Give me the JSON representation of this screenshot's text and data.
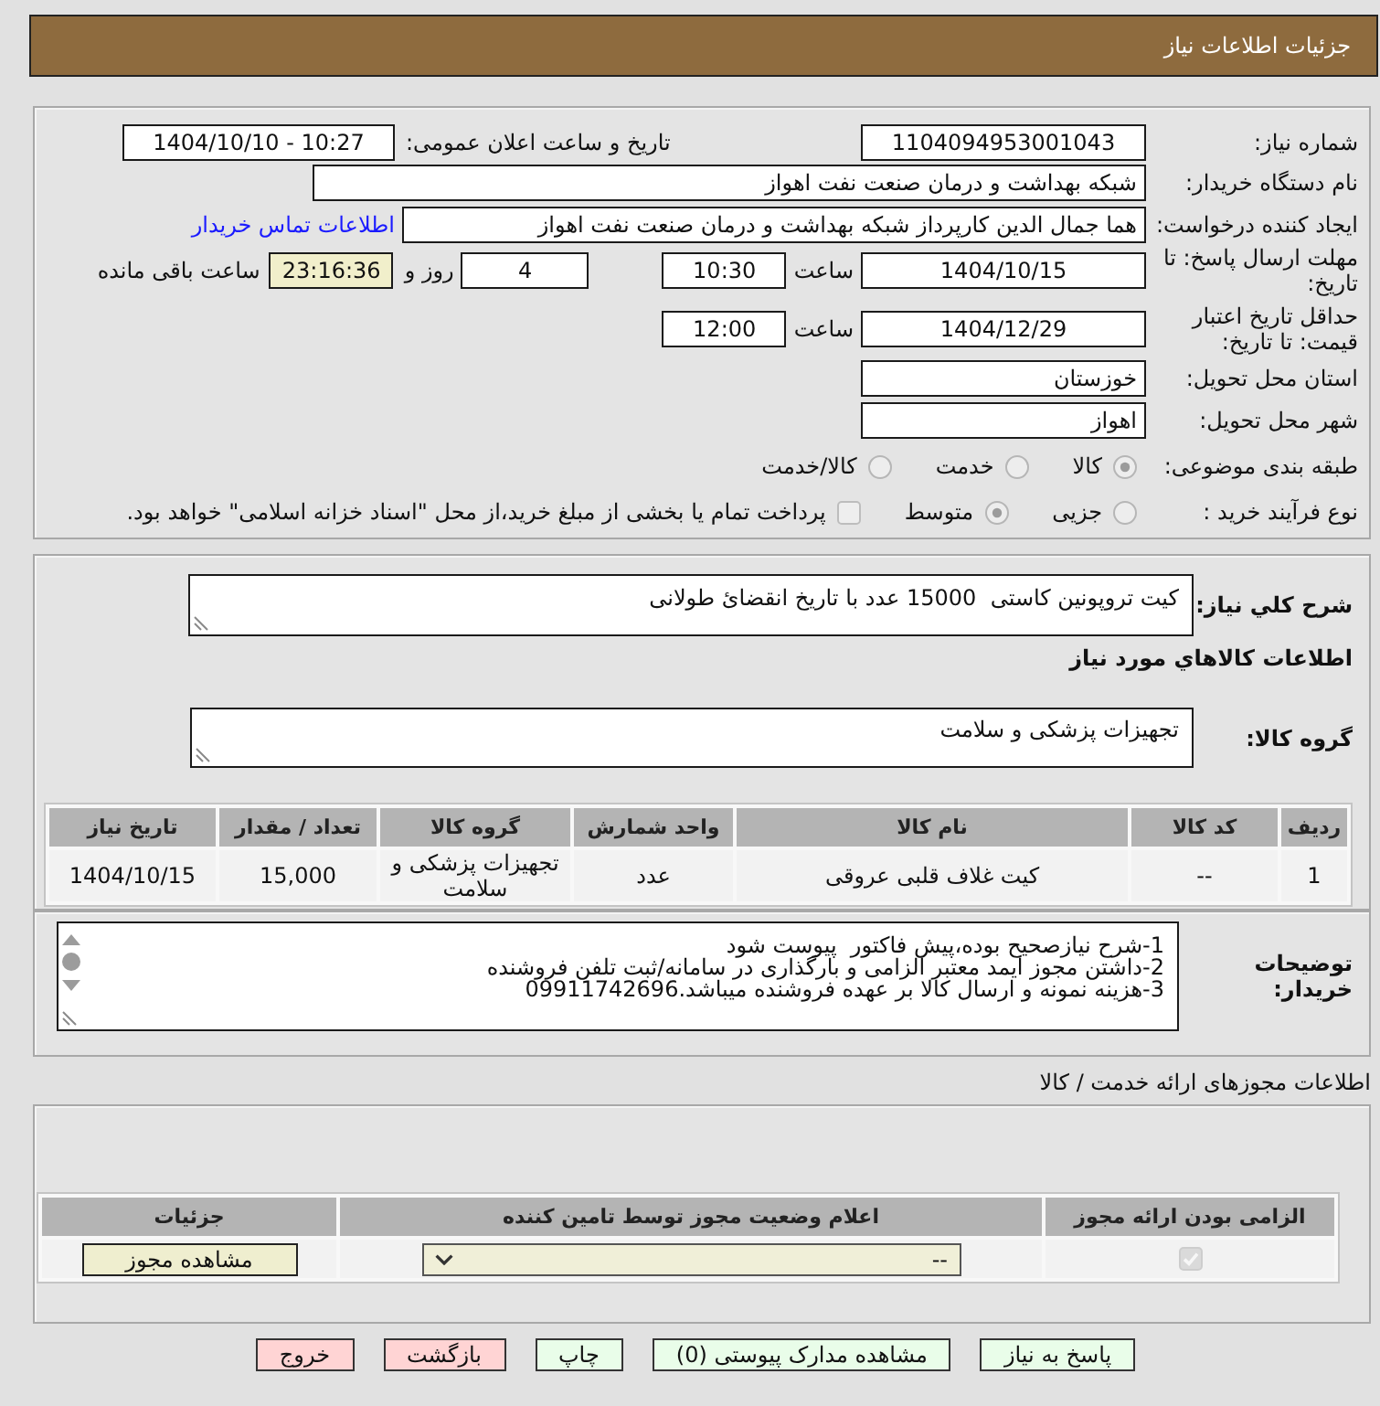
{
  "header": {
    "title": "جزئیات اطلاعات نیاز"
  },
  "details": {
    "need_number": {
      "label": "شماره نیاز:",
      "value": "1104094953001043"
    },
    "announcement": {
      "label": "تاریخ و ساعت اعلان عمومی:",
      "value": "1404/10/10 - 10:27"
    },
    "buyer": {
      "label": "نام دستگاه خریدار:",
      "value": "شبکه بهداشت و درمان صنعت نفت اهواز"
    },
    "requester": {
      "label": "ایجاد کننده درخواست:",
      "value": "هما جمال الدین کارپرداز شبکه بهداشت و درمان صنعت نفت اهواز",
      "contact_link": "اطلاعات تماس خریدار"
    },
    "response_deadline": {
      "label": "مهلت ارسال پاسخ: تا تاریخ:",
      "date": "1404/10/15",
      "time_label": "ساعت",
      "time": "10:30",
      "days": "4",
      "days_label": "روز و",
      "remaining": "23:16:36",
      "remaining_label": "ساعت باقی مانده"
    },
    "price_validity": {
      "label": "حداقل تاریخ اعتبار قیمت: تا تاریخ:",
      "date": "1404/12/29",
      "time_label": "ساعت",
      "time": "12:00"
    },
    "delivery_province": {
      "label": "استان محل تحویل:",
      "value": "خوزستان"
    },
    "delivery_city": {
      "label": "شهر محل تحویل:",
      "value": "اهواز"
    },
    "category": {
      "label": "طبقه بندی موضوعی:",
      "options": [
        {
          "label": "کالا",
          "selected": true
        },
        {
          "label": "خدمت",
          "selected": false
        },
        {
          "label": "کالا/خدمت",
          "selected": false
        }
      ]
    },
    "purchase_process": {
      "label": "نوع فرآیند خرید :",
      "options": [
        {
          "label": "جزیی",
          "selected": false
        },
        {
          "label": "متوسط",
          "selected": true
        }
      ],
      "treasury_option": {
        "label": "پرداخت تمام یا بخشی از مبلغ خرید،از محل \"اسناد خزانه اسلامی\" خواهد بود.",
        "checked": false
      }
    }
  },
  "need_description": {
    "label": "شرح کلي نیاز:",
    "value": "کیت تروپونین کاستی  15000 عدد با تاریخ انقضائ طولانی"
  },
  "goods": {
    "title": "اطلاعات کالاهاي مورد نیاز",
    "group_label": "گروه کالا:",
    "group_value": "تجهیزات پزشکی و سلامت",
    "table": {
      "columns": [
        "ردیف",
        "کد کالا",
        "نام کالا",
        "واحد شمارش",
        "گروه کالا",
        "تعداد / مقدار",
        "تاریخ نیاز"
      ],
      "rows": [
        [
          "1",
          "--",
          "کیت غلاف قلبی عروقی",
          "عدد",
          "تجهیزات پزشکی و سلامت",
          "15,000",
          "1404/10/15"
        ]
      ]
    }
  },
  "buyer_notes": {
    "label": "توضیحات خریدار:",
    "lines": [
      "1-شرح نیازصحیح بوده،پیش فاکتور  پیوست شود",
      "2-داشتن مجوز ایمد معتبر الزامی و بارگذاری در سامانه/ثبت تلفن فروشنده",
      "3-هزینه نمونه و ارسال کالا بر عهده فروشنده میباشد.09911742696"
    ]
  },
  "licenses": {
    "title": "اطلاعات مجوزهای ارائه خدمت / کالا",
    "columns": [
      "الزامی بودن ارائه مجوز",
      "اعلام وضعیت مجوز توسط تامین کننده",
      "جزئیات"
    ],
    "rows": [
      {
        "required": true,
        "status": "--",
        "details_button": "مشاهده مجوز"
      }
    ]
  },
  "actions": [
    {
      "label": "پاسخ به نیاز",
      "kind": "normal"
    },
    {
      "label": "مشاهده مدارک پیوستی (0)",
      "kind": "normal"
    },
    {
      "label": "چاپ",
      "kind": "normal"
    },
    {
      "label": "بازگشت",
      "kind": "cancel"
    },
    {
      "label": "خروج",
      "kind": "cancel"
    }
  ]
}
